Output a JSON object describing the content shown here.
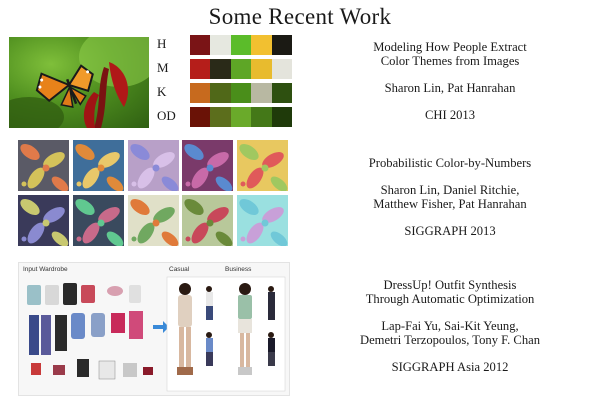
{
  "title": "Some Recent Work",
  "theme_rows": [
    {
      "label": "H",
      "colors": [
        "#7a1416",
        "#e6e8e0",
        "#5bbc2a",
        "#f2c030",
        "#1b1a14"
      ]
    },
    {
      "label": "M",
      "colors": [
        "#b51e1a",
        "#2a2a18",
        "#5ea626",
        "#e8bb2e",
        "#e4e4dc"
      ]
    },
    {
      "label": "K",
      "colors": [
        "#c76a1e",
        "#506818",
        "#4a8e1a",
        "#b8b8a2",
        "#2e5010"
      ]
    },
    {
      "label": "OD",
      "colors": [
        "#6a1206",
        "#5c6e1c",
        "#6aaa2a",
        "#447818",
        "#1f3a0a"
      ]
    }
  ],
  "works": [
    {
      "title": [
        "Modeling How People Extract",
        "Color Themes from Images"
      ],
      "authors": [
        "Sharon Lin, Pat Hanrahan"
      ],
      "venue": "CHI 2013"
    },
    {
      "title": [
        "Probabilistic Color-by-Numbers"
      ],
      "authors": [
        "Sharon Lin, Daniel Ritchie,",
        "Matthew Fisher, Pat Hanrahan"
      ],
      "venue": "SIGGRAPH 2013"
    },
    {
      "title": [
        "DressUp! Outfit Synthesis",
        "Through Automatic Optimization"
      ],
      "authors": [
        "Lap-Fai Yu, Sai-Kit Yeung,",
        "Demetri Terzopoulos, Tony F. Chan"
      ],
      "venue": "SIGGRAPH Asia 2012"
    }
  ],
  "pattern_tiles": [
    {
      "bg": "#5a5a66",
      "leaf": "#e07a4a",
      "leaf2": "#d4c25a"
    },
    {
      "bg": "#3f6e9a",
      "leaf": "#e08a3a",
      "leaf2": "#e8c86a"
    },
    {
      "bg": "#b8a0c8",
      "leaf": "#8a8ad8",
      "leaf2": "#d8c0e8"
    },
    {
      "bg": "#7a3a6a",
      "leaf": "#5a8ad0",
      "leaf2": "#c86aa8"
    },
    {
      "bg": "#e8c860",
      "leaf": "#a0c860",
      "leaf2": "#e05a5a"
    },
    {
      "bg": "#3a3a5a",
      "leaf": "#c8c870",
      "leaf2": "#8a8ad0"
    },
    {
      "bg": "#3a4a5e",
      "leaf": "#60c890",
      "leaf2": "#c86a8a"
    },
    {
      "bg": "#e0e0c8",
      "leaf": "#e07a3a",
      "leaf2": "#70a860"
    },
    {
      "bg": "#b8c89a",
      "leaf": "#6a8a3a",
      "leaf2": "#c8485a"
    },
    {
      "bg": "#9ae0e0",
      "leaf": "#70c8d8",
      "leaf2": "#c8a0d8"
    }
  ],
  "outfit_labels": {
    "wardrobe": "Input Wardrobe",
    "casual": "Casual",
    "business": "Business"
  }
}
